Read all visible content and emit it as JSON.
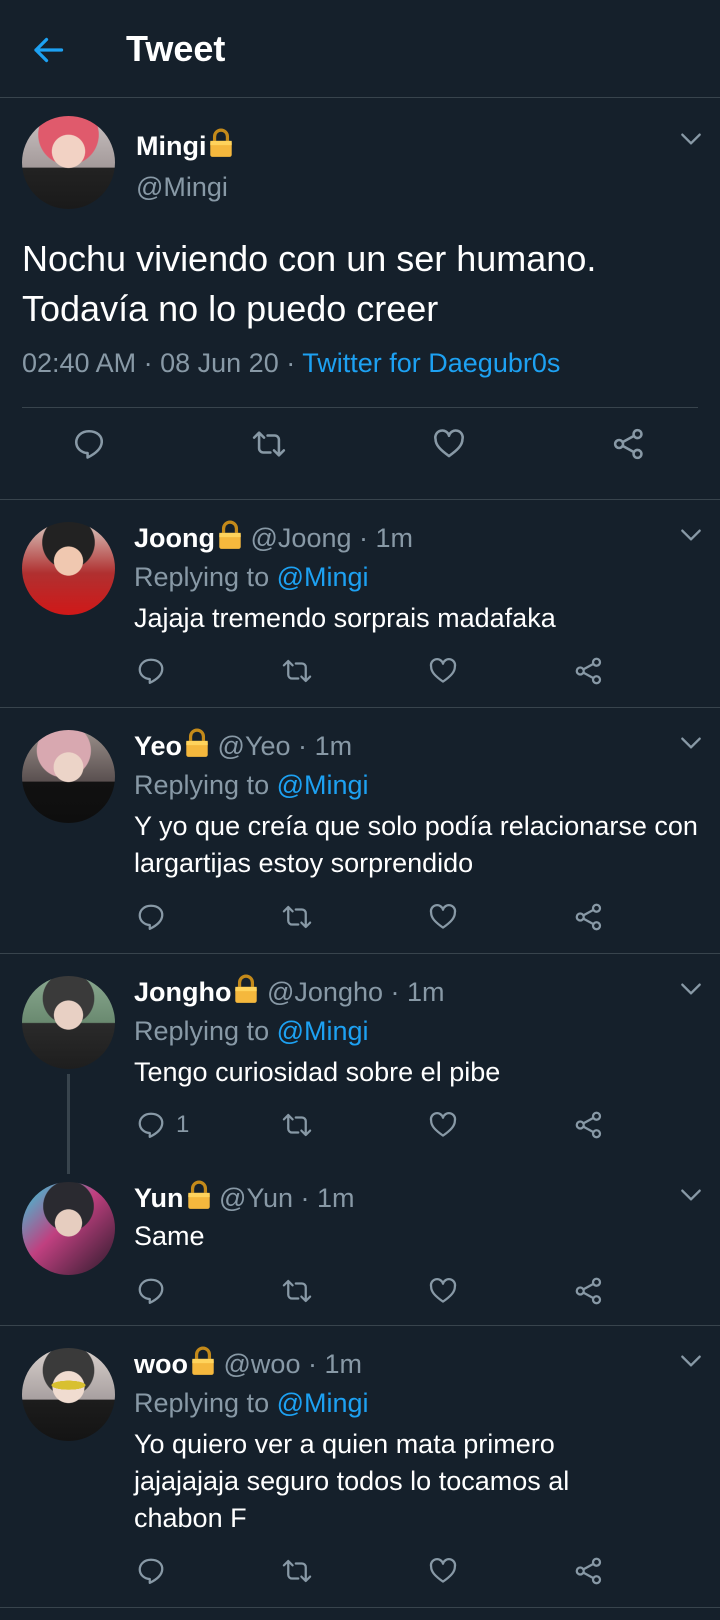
{
  "header": {
    "title": "Tweet",
    "back_icon": "arrow-left-icon",
    "accent": "#1da1f2"
  },
  "main_tweet": {
    "name": "Mingi",
    "handle": "@Mingi",
    "text": "Nochu viviendo con un ser humano. Todavía no lo puedo creer",
    "time": "02:40 AM",
    "date": "08 Jun 20",
    "source": "Twitter for Daegubr0s",
    "actions": [
      "reply-icon",
      "retweet-icon",
      "like-icon",
      "share-icon"
    ]
  },
  "replies": [
    {
      "name": "Joong",
      "handle": "@Joong",
      "time": "1m",
      "replying_label": "Replying to",
      "replying_to": "@Mingi",
      "text": "Jajaja tremendo sorprais madafaka",
      "reply_count": ""
    },
    {
      "name": "Yeo",
      "handle": "@Yeo",
      "time": "1m",
      "replying_label": "Replying to",
      "replying_to": "@Mingi",
      "text": "Y yo que creía que solo podía relacionarse con largartijas estoy sorprendido",
      "reply_count": ""
    },
    {
      "name": "Jongho",
      "handle": "@Jongho",
      "time": "1m",
      "replying_label": "Replying to",
      "replying_to": "@Mingi",
      "text": "Tengo curiosidad sobre el pibe",
      "reply_count": "1"
    },
    {
      "name": "Yun",
      "handle": "@Yun",
      "time": "1m",
      "text": "Same",
      "reply_count": ""
    },
    {
      "name": "woo",
      "handle": "@woo",
      "time": "1m",
      "replying_label": "Replying to",
      "replying_to": "@Mingi",
      "text": "Yo quiero ver a quien mata primero jajajajaja seguro todos lo tocamos al chabon F",
      "reply_count": ""
    }
  ],
  "separator": "·",
  "colors": {
    "background": "#15202b",
    "text": "#ffffff",
    "muted": "#8899a6",
    "link": "#1da1f2",
    "divider": "#38444d",
    "lock": "#f5b83d"
  }
}
